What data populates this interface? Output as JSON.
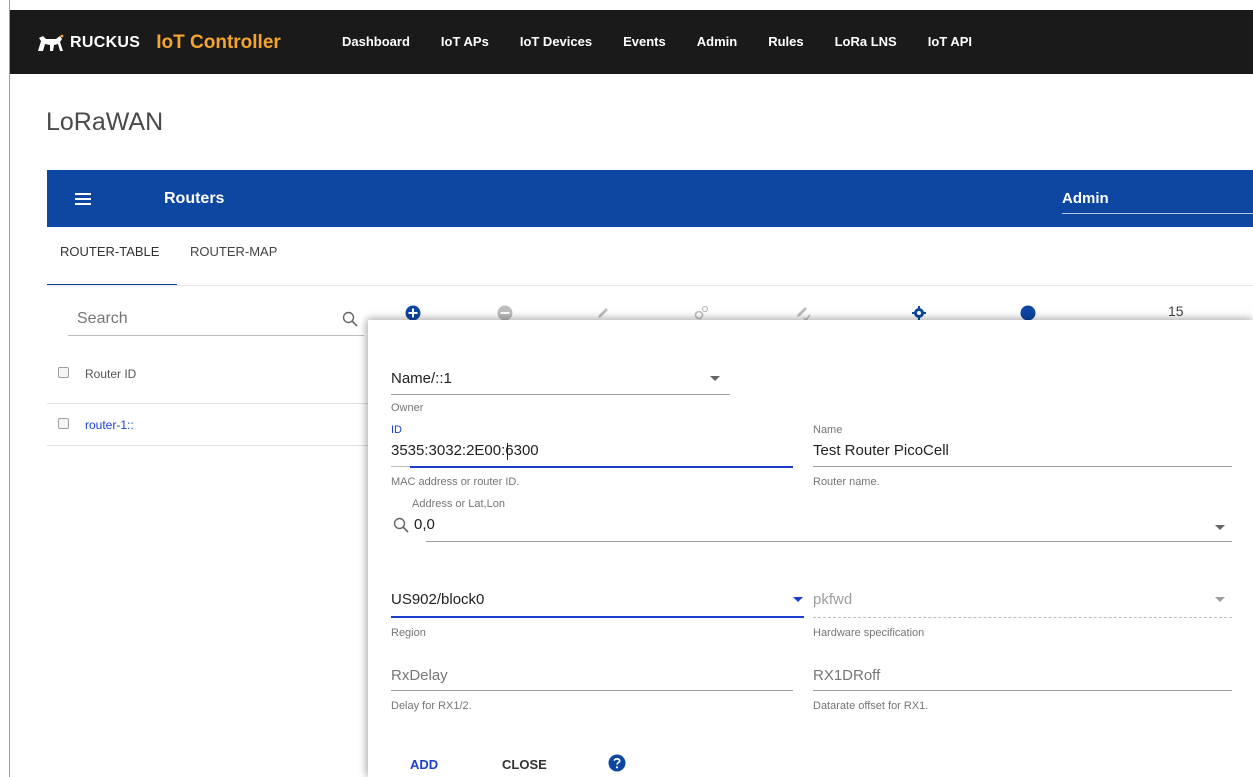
{
  "colors": {
    "nav_bg": "#1a1a1a",
    "appbar_bg": "#0d47a1",
    "brand_accent": "#f3a52e",
    "link_blue": "#1a3fcf"
  },
  "nav": {
    "brand_name": "RUCKUS",
    "product_name": "IoT Controller",
    "links": [
      "Dashboard",
      "IoT APs",
      "IoT Devices",
      "Events",
      "Admin",
      "Rules",
      "LoRa LNS",
      "IoT API"
    ]
  },
  "page": {
    "title": "LoRaWAN"
  },
  "appbar": {
    "title": "Routers",
    "user": "Admin",
    "menu_icon": "menu-icon"
  },
  "tabs": [
    {
      "label": "ROUTER-TABLE",
      "active": true
    },
    {
      "label": "ROUTER-MAP",
      "active": false
    }
  ],
  "search": {
    "placeholder": "Search",
    "icon": "search-icon"
  },
  "toolbar": {
    "icons": [
      "add-circle-icon",
      "remove-circle-icon",
      "edit-icon",
      "gears-icon",
      "edit-check-icon",
      "gear-icon",
      "help-icon"
    ],
    "row_count": "15"
  },
  "table": {
    "columns": [
      "Router ID"
    ],
    "rows": [
      {
        "router_id": "router-1::"
      }
    ]
  },
  "dialog": {
    "owner": {
      "value": "Name/::1",
      "label": "Owner"
    },
    "id": {
      "label": "ID",
      "value_before_cursor": "3535:3032:2E00:",
      "value_after_cursor": "6300",
      "hint": "MAC address or router ID."
    },
    "name": {
      "label": "Name",
      "value": "Test Router PicoCell",
      "hint": "Router name."
    },
    "address": {
      "label": "Address or Lat,Lon",
      "value": "0,0"
    },
    "region": {
      "value": "US902/block0",
      "label": "Region"
    },
    "hardware": {
      "placeholder": "pkfwd",
      "hint": "Hardware specification"
    },
    "rxdelay": {
      "placeholder": "RxDelay",
      "hint": "Delay for RX1/2."
    },
    "rx1droff": {
      "placeholder": "RX1DRoff",
      "hint": "Datarate offset for RX1."
    },
    "buttons": {
      "add": "ADD",
      "close": "CLOSE",
      "help_icon": "help-icon"
    }
  }
}
